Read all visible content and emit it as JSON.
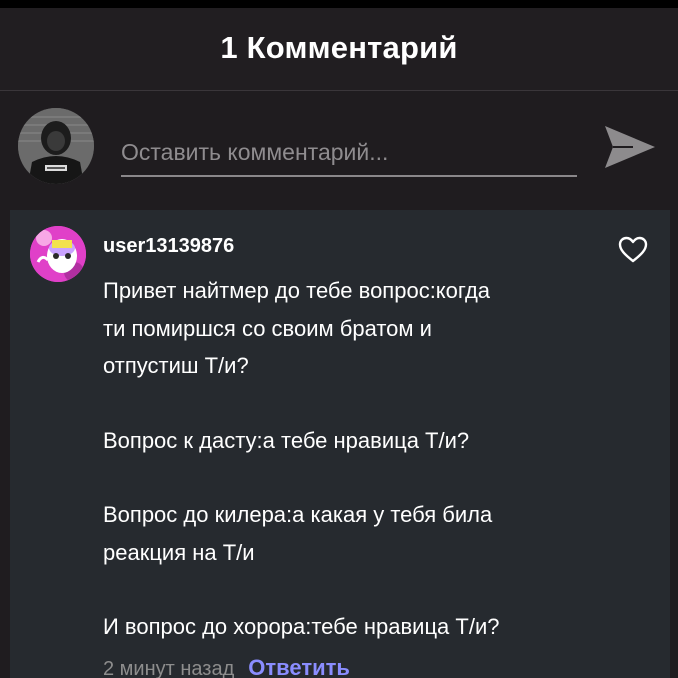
{
  "header": {
    "title": "1 Комментарий"
  },
  "compose": {
    "placeholder": "Оставить комментарий...",
    "avatar_icon": "user-avatar-icon",
    "send_icon": "send-icon"
  },
  "comment": {
    "username": "user13139876",
    "paragraphs": [
      "Привет найтмер до тебе вопрос:когда\nти помиршся со своим братом и\nотпустиш Т/и?",
      "Вопрос к дасту:а тебе нравица Т/и?",
      "Вопрос до килера:а какая у тебя била\nреакция на Т/и",
      "И вопрос до хорора:тебе нравица Т/и?"
    ],
    "timestamp": "2 минут назад",
    "reply_label": "Ответить",
    "like_icon": "heart-icon"
  },
  "colors": {
    "background": "#1f1c1f",
    "comment_card": "#262a2f",
    "reply_link": "#8a8dff",
    "timestamp": "#8d8d8d"
  }
}
